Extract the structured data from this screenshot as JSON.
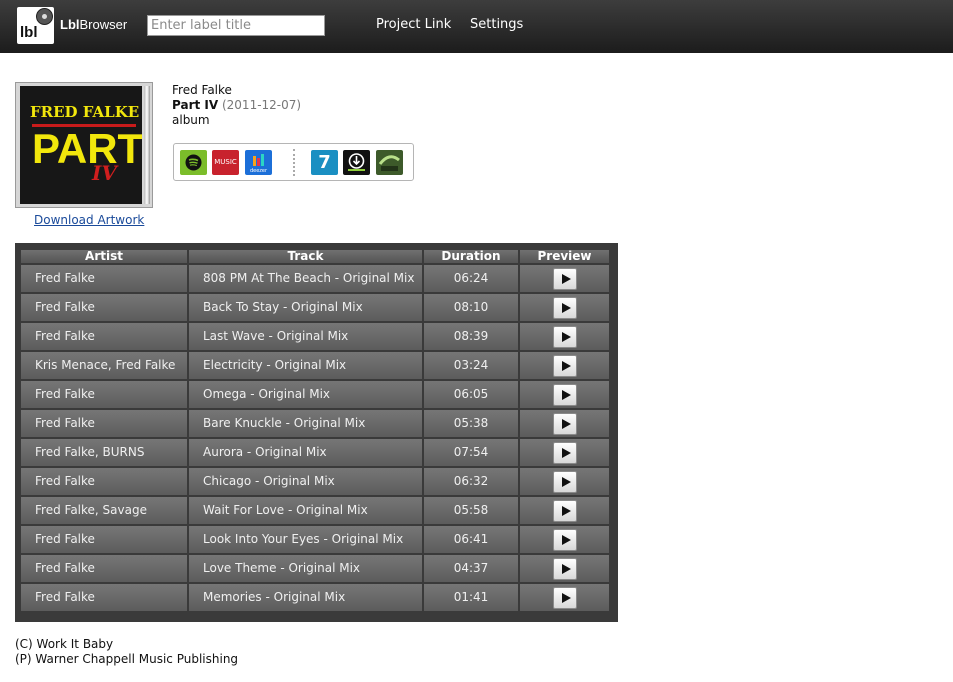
{
  "brand": {
    "bold": "Lbl",
    "rest": "Browser",
    "logo_text": "lbl"
  },
  "search": {
    "placeholder": "Enter label title"
  },
  "nav": {
    "project_link": "Project Link",
    "settings": "Settings"
  },
  "album": {
    "artist": "Fred Falke",
    "title": "Part IV",
    "date": "(2011-12-07)",
    "type": "album",
    "download_artwork": "Download Artwork",
    "cover_text": {
      "line1": "FRED FALKE",
      "line2": "PART",
      "line3": "IV"
    }
  },
  "services": [
    {
      "name": "spotify-icon",
      "color": "#1db954"
    },
    {
      "name": "apple-music-icon",
      "label": "MUSIC",
      "color": "#c8222d"
    },
    {
      "name": "deezer-icon",
      "label": "deezer",
      "color": "#1c6fd8"
    },
    {
      "name": "7digital-icon",
      "label": "7",
      "color": "#1a8fc2"
    },
    {
      "name": "beatport-icon",
      "color": "#111111"
    },
    {
      "name": "juno-download-icon",
      "color": "#3d5a2a"
    }
  ],
  "table": {
    "headers": {
      "artist": "Artist",
      "track": "Track",
      "duration": "Duration",
      "preview": "Preview"
    },
    "rows": [
      {
        "artist": "Fred Falke",
        "track": "808 PM At The Beach - Original Mix",
        "duration": "06:24"
      },
      {
        "artist": "Fred Falke",
        "track": "Back To Stay - Original Mix",
        "duration": "08:10"
      },
      {
        "artist": "Fred Falke",
        "track": "Last Wave - Original Mix",
        "duration": "08:39"
      },
      {
        "artist": "Kris Menace, Fred Falke",
        "track": "Electricity - Original Mix",
        "duration": "03:24"
      },
      {
        "artist": "Fred Falke",
        "track": "Omega - Original Mix",
        "duration": "06:05"
      },
      {
        "artist": "Fred Falke",
        "track": "Bare Knuckle - Original Mix",
        "duration": "05:38"
      },
      {
        "artist": "Fred Falke, BURNS",
        "track": "Aurora - Original Mix",
        "duration": "07:54"
      },
      {
        "artist": "Fred Falke",
        "track": "Chicago - Original Mix",
        "duration": "06:32"
      },
      {
        "artist": "Fred Falke, Savage",
        "track": "Wait For Love - Original Mix",
        "duration": "05:58"
      },
      {
        "artist": "Fred Falke",
        "track": "Look Into Your Eyes - Original Mix",
        "duration": "06:41"
      },
      {
        "artist": "Fred Falke",
        "track": "Love Theme - Original Mix",
        "duration": "04:37"
      },
      {
        "artist": "Fred Falke",
        "track": "Memories - Original Mix",
        "duration": "01:41"
      }
    ]
  },
  "footer": {
    "copyright": "(C) Work It Baby",
    "publishing": "(P) Warner Chappell Music Publishing"
  }
}
